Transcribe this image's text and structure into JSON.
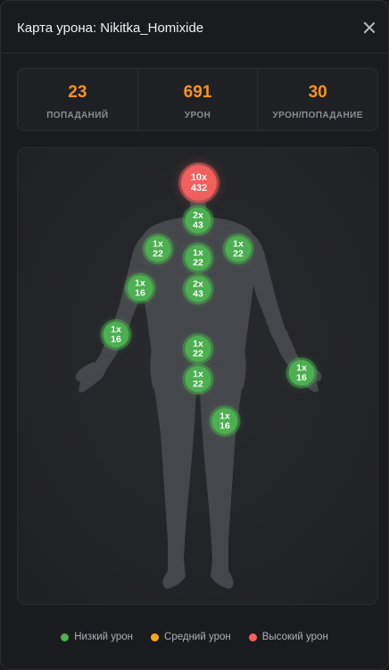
{
  "header": {
    "title": "Карта урона: Nikitka_Homixide"
  },
  "stats": [
    {
      "value": "23",
      "label": "ПОПАДАНИЙ"
    },
    {
      "value": "691",
      "label": "УРОН"
    },
    {
      "value": "30",
      "label": "УРОН/ПОПАДАНИЕ"
    }
  ],
  "markers": [
    {
      "count": "10x",
      "damage": "432",
      "level": "high"
    },
    {
      "count": "2x",
      "damage": "43",
      "level": "low"
    },
    {
      "count": "1x",
      "damage": "22",
      "level": "low"
    },
    {
      "count": "1x",
      "damage": "22",
      "level": "low"
    },
    {
      "count": "1x",
      "damage": "22",
      "level": "low"
    },
    {
      "count": "1x",
      "damage": "16",
      "level": "low"
    },
    {
      "count": "2x",
      "damage": "43",
      "level": "low"
    },
    {
      "count": "1x",
      "damage": "16",
      "level": "low"
    },
    {
      "count": "1x",
      "damage": "22",
      "level": "low"
    },
    {
      "count": "1x",
      "damage": "22",
      "level": "low"
    },
    {
      "count": "1x",
      "damage": "16",
      "level": "low"
    },
    {
      "count": "1x",
      "damage": "16",
      "level": "low"
    }
  ],
  "legend": [
    {
      "label": "Низкий урон",
      "color": "#4caf50"
    },
    {
      "label": "Средний урон",
      "color": "#f5a623"
    },
    {
      "label": "Высокий урон",
      "color": "#f25f5c"
    }
  ],
  "colors": {
    "accent": "#f7931e",
    "low": "#4caf50",
    "medium": "#f5a623",
    "high": "#f25f5c"
  }
}
